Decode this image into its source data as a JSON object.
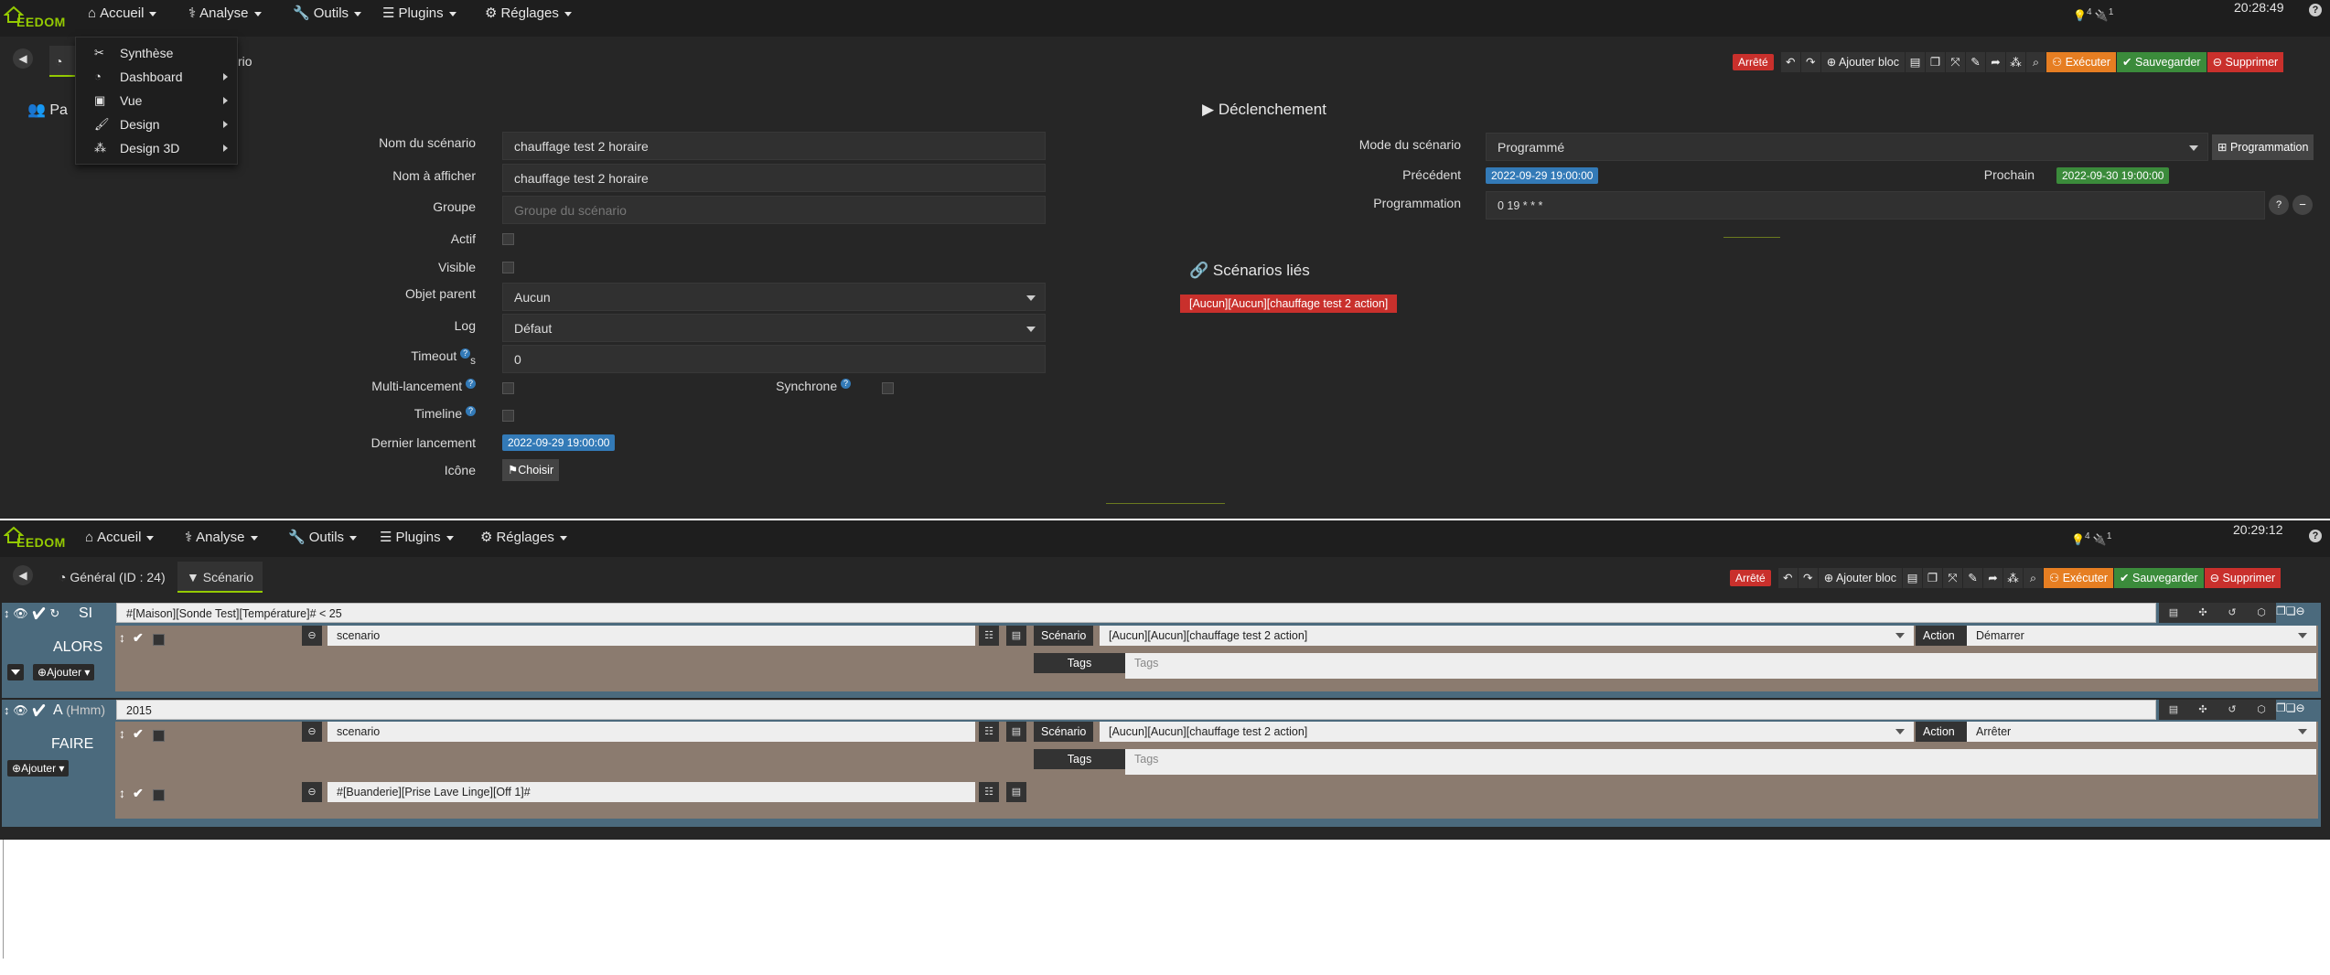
{
  "brand": {
    "logo_text": "EEDOM"
  },
  "nav": {
    "accueil": "Accueil",
    "analyse": "Analyse",
    "outils": "Outils",
    "plugins": "Plugins",
    "reglages": "Réglages"
  },
  "shot1": {
    "clock": "20:28:49",
    "notif_a": "4",
    "notif_b": "1",
    "dropdown": [
      {
        "label": "Synthèse",
        "icon": "synthese-icon"
      },
      {
        "label": "Dashboard",
        "icon": "dashboard-icon"
      },
      {
        "label": "Vue",
        "icon": "picture-icon"
      },
      {
        "label": "Design",
        "icon": "brush-icon"
      },
      {
        "label": "Design 3D",
        "icon": "cubes-icon"
      }
    ],
    "tab_partial": "rio",
    "left_partial": "Pa",
    "toolbar": {
      "status": "Arrêté",
      "add_block": "Ajouter bloc",
      "execute": "Exécuter",
      "save": "Sauvegarder",
      "delete": "Supprimer"
    },
    "form": {
      "name_label": "Nom du scénario",
      "name_value": "chauffage test 2 horaire",
      "display_label": "Nom à afficher",
      "display_value": "chauffage test 2 horaire",
      "group_label": "Groupe",
      "group_placeholder": "Groupe du scénario",
      "active_label": "Actif",
      "visible_label": "Visible",
      "parent_label": "Objet parent",
      "parent_value": "Aucun",
      "log_label": "Log",
      "log_value": "Défaut",
      "timeout_label": "Timeout",
      "timeout_unit": "s",
      "timeout_value": "0",
      "multi_label": "Multi-lancement",
      "sync_label": "Synchrone",
      "timeline_label": "Timeline",
      "last_label": "Dernier lancement",
      "last_value": "2022-09-29 19:00:00",
      "icon_label": "Icône",
      "choose_label": "Choisir"
    },
    "trigger": {
      "title": "Déclenchement",
      "mode_label": "Mode du scénario",
      "mode_value": "Programmé",
      "programmation_btn": "Programmation",
      "prev_label": "Précédent",
      "prev_value": "2022-09-29 19:00:00",
      "next_label": "Prochain",
      "next_value": "2022-09-30 19:00:00",
      "prog_label": "Programmation",
      "prog_value": "0 19 * * *"
    },
    "linked": {
      "title": "Scénarios liés",
      "item": "[Aucun][Aucun][chauffage test 2 action]"
    }
  },
  "shot2": {
    "clock": "20:29:12",
    "notif_a": "4",
    "notif_b": "1",
    "tab_general": "Général (ID : 24)",
    "tab_scenario": "Scénario",
    "toolbar": {
      "status": "Arrêté",
      "add_block": "Ajouter bloc",
      "execute": "Exécuter",
      "save": "Sauvegarder",
      "delete": "Supprimer"
    },
    "block1": {
      "keyword": "SI",
      "condition": "#[Maison][Sonde Test][Température]# < 25",
      "then": "ALORS",
      "add": "Ajouter",
      "action_type": "scenario",
      "scenario_label": "Scénario",
      "scenario_value": "[Aucun][Aucun][chauffage test 2 action]",
      "action_label": "Action",
      "action_value": "Démarrer",
      "tags_label": "Tags",
      "tags_placeholder": "Tags"
    },
    "block2": {
      "keyword": "A",
      "keyword_hint": "(Hmm)",
      "time_value": "2015",
      "do": "FAIRE",
      "add": "Ajouter",
      "action_type": "scenario",
      "scenario_label": "Scénario",
      "scenario_value": "[Aucun][Aucun][chauffage test 2 action]",
      "action_label": "Action",
      "action_value": "Arrêter",
      "tags_label": "Tags",
      "tags_placeholder": "Tags",
      "cmd_value": "#[Buanderie][Prise Lave Linge][Off 1]#"
    }
  }
}
